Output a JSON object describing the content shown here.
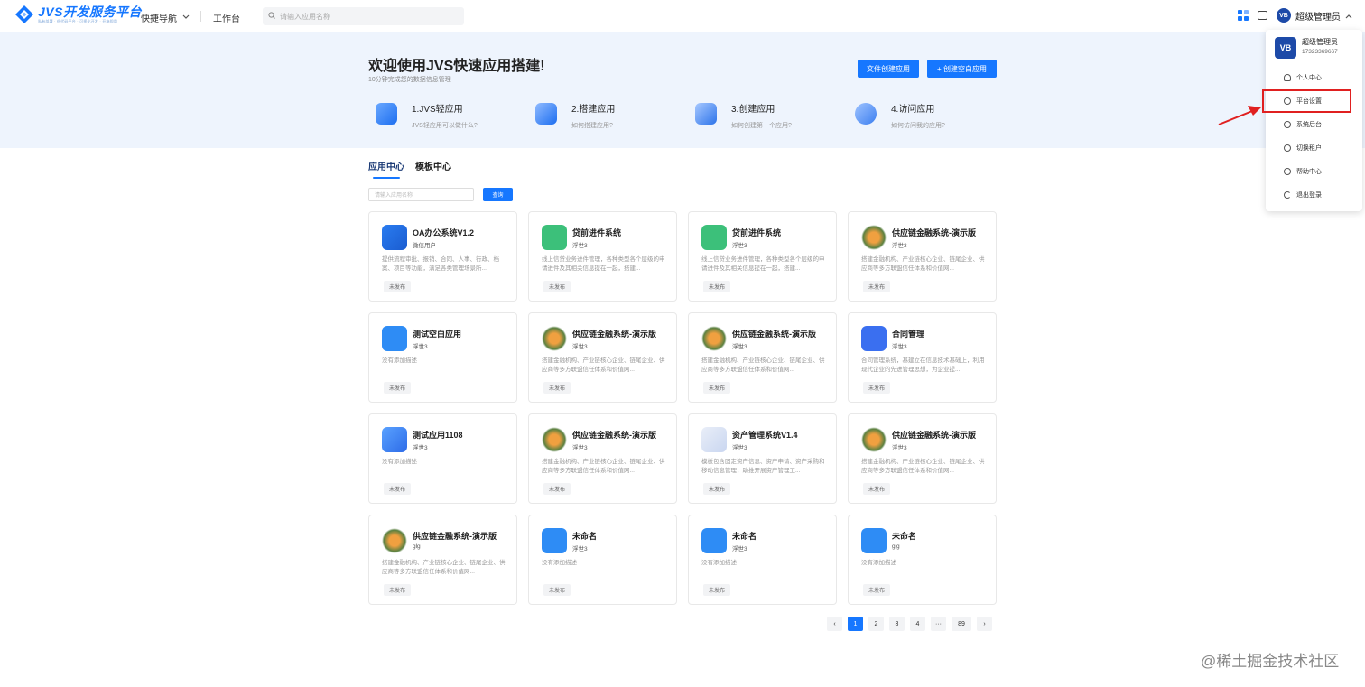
{
  "header": {
    "logo_title": "JVS开发服务平台",
    "logo_subtitle": "私有部署 · 低代码平台 · 可视化开发 · 开箱即用",
    "quick_nav": "快捷导航",
    "workbench": "工作台",
    "search_placeholder": "请输入应用名称",
    "user_name": "超级管理员",
    "avatar_text": "VB"
  },
  "hero": {
    "title": "欢迎使用JVS快速应用搭建!",
    "subtitle": "10分钟完成您的数据信息管理",
    "btn_file_create": "文件创建应用",
    "btn_blank_create": "+ 创建空白应用",
    "steps": [
      {
        "title": "1.JVS轻应用",
        "desc": "JVS轻应用可以做什么?"
      },
      {
        "title": "2.搭建应用",
        "desc": "如何搭建应用?"
      },
      {
        "title": "3.创建应用",
        "desc": "如何创建第一个应用?"
      },
      {
        "title": "4.访问应用",
        "desc": "如何访问我的应用?"
      }
    ]
  },
  "tabs": [
    "应用中心",
    "模板中心"
  ],
  "app_search": {
    "placeholder": "请输入应用名称",
    "button": "查询"
  },
  "cards": [
    {
      "name": "OA办公系统V1.2",
      "owner": "微信用户",
      "desc": "提供流程审批、报销、合同、人事、行政、档案、项目等功能，满足各类管理场景所...",
      "status": "未发布",
      "icon": "oa-icon"
    },
    {
      "name": "贷前进件系统",
      "owner": "浮世3",
      "desc": "线上信贷业务进件管理，各种类型各个层级的申请进件及其相关信息提在一起，搭建...",
      "status": "未发布",
      "icon": "user-card-icon"
    },
    {
      "name": "贷前进件系统",
      "owner": "浮世3",
      "desc": "线上信贷业务进件管理，各种类型各个层级的申请进件及其相关信息提在一起，搭建...",
      "status": "未发布",
      "icon": "user-card-icon"
    },
    {
      "name": "供应链金融系统-演示版",
      "owner": "浮世3",
      "desc": "搭建金融机构、产业链核心企业、链尾企业、供应商等多方联盟信任体系和价值网...",
      "status": "未发布",
      "icon": "supply-chain-icon"
    },
    {
      "name": "测试空白应用",
      "owner": "浮世3",
      "desc": "没有添加描述",
      "status": "未发布",
      "icon": "bar-chart-icon"
    },
    {
      "name": "供应链金融系统-演示版",
      "owner": "浮世3",
      "desc": "搭建金融机构、产业链核心企业、链尾企业、供应商等多方联盟信任体系和价值网...",
      "status": "未发布",
      "icon": "supply-chain-icon"
    },
    {
      "name": "供应链金融系统-演示版",
      "owner": "浮世3",
      "desc": "搭建金融机构、产业链核心企业、链尾企业、供应商等多方联盟信任体系和价值网...",
      "status": "未发布",
      "icon": "supply-chain-icon"
    },
    {
      "name": "合同管理",
      "owner": "浮世3",
      "desc": "合同管理系统，基建立在信息技术基础上，利用现代企业的先进管理思想，为企业提...",
      "status": "未发布",
      "icon": "book-icon"
    },
    {
      "name": "测试应用1108",
      "owner": "浮世3",
      "desc": "没有添加描述",
      "status": "未发布",
      "icon": "wand-icon"
    },
    {
      "name": "供应链金融系统-演示版",
      "owner": "浮世3",
      "desc": "搭建金融机构、产业链核心企业、链尾企业、供应商等多方联盟信任体系和价值网...",
      "status": "未发布",
      "icon": "supply-chain-icon"
    },
    {
      "name": "资产管理系统V1.4",
      "owner": "浮世3",
      "desc": "模板包含固定资产信息、资产申请、资产采购和移动信息管理，助推开展资产管理工...",
      "status": "未发布",
      "icon": "asset-icon"
    },
    {
      "name": "供应链金融系统-演示版",
      "owner": "浮世3",
      "desc": "搭建金融机构、产业链核心企业、链尾企业、供应商等多方联盟信任体系和价值网...",
      "status": "未发布",
      "icon": "supply-chain-icon"
    },
    {
      "name": "供应链金融系统-演示版",
      "owner": "glg",
      "desc": "搭建金融机构、产业链核心企业、链尾企业、供应商等多方联盟信任体系和价值网...",
      "status": "未发布",
      "icon": "supply-chain-icon"
    },
    {
      "name": "未命名",
      "owner": "浮世3",
      "desc": "没有添加描述",
      "status": "未发布",
      "icon": "bar-chart-icon"
    },
    {
      "name": "未命名",
      "owner": "浮世3",
      "desc": "没有添加描述",
      "status": "未发布",
      "icon": "bar-chart-icon"
    },
    {
      "name": "未命名",
      "owner": "glg",
      "desc": "没有添加描述",
      "status": "未发布",
      "icon": "bar-chart-icon"
    }
  ],
  "pagination": {
    "prev": "‹",
    "pages": [
      "1",
      "2",
      "3",
      "4",
      "···",
      "89"
    ],
    "next": "›",
    "current": "1"
  },
  "user_menu": {
    "name": "超级管理员",
    "phone": "17323369667",
    "items": [
      "个人中心",
      "平台设置",
      "系统后台",
      "切换租户",
      "帮助中心",
      "退出登录"
    ]
  },
  "watermark": "@稀土掘金技术社区",
  "colors": {
    "accent": "#1677ff",
    "highlight": "#e02020",
    "hero_bg": "#eef4fd"
  }
}
